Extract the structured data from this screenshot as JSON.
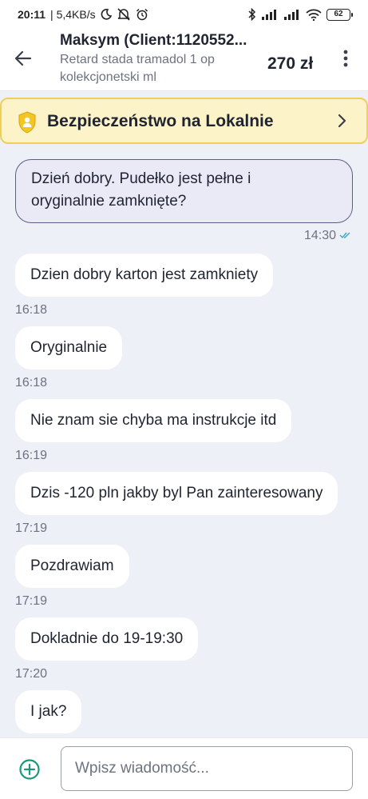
{
  "status_bar": {
    "time": "20:11",
    "speed": "| 5,4KB/s",
    "battery": "62",
    "icons": [
      "moon-icon",
      "mute-icon",
      "alarm-icon",
      "bluetooth-icon",
      "signal-icon",
      "signal-icon",
      "wifi-icon",
      "battery-icon"
    ]
  },
  "header": {
    "contact_name": "Maksym (Client:1120552...",
    "subtitle_line1": "Retard stada tramadol 1 op",
    "subtitle_line2": "kolekcjonetski ml",
    "price": "270 zł"
  },
  "banner": {
    "text": "Bezpieczeństwo na Lokalnie",
    "accent_color": "#efcf57",
    "background": "#fdf3c8"
  },
  "messages": [
    {
      "direction": "out",
      "line1": "Dzień dobry. Pudełko jest pełne i",
      "line2": "oryginalnie zamknięte?",
      "time": "14:30"
    },
    {
      "direction": "in",
      "text": "Dzien dobry karton jest zamkniety",
      "time": "16:18"
    },
    {
      "direction": "in",
      "text": "Oryginalnie",
      "time": "16:18"
    },
    {
      "direction": "in",
      "text": "Nie znam sie chyba ma instrukcje itd",
      "time": "16:19"
    },
    {
      "direction": "in",
      "text": "Dzis -120 pln jakby byl Pan zainteresowany",
      "time": "17:19"
    },
    {
      "direction": "in",
      "text": "Pozdrawiam",
      "time": "17:19"
    },
    {
      "direction": "in",
      "text": "Dokladnie do 19-19:30",
      "time": "17:20"
    },
    {
      "direction": "in",
      "text": "I jak?",
      "time": ""
    }
  ],
  "input": {
    "placeholder": "Wpisz wiadomość...",
    "value": ""
  },
  "colors": {
    "chat_background": "#eef0f7",
    "outgoing_bubble": "#eaeaf6",
    "outgoing_border": "#5a5f84",
    "add_button": "#1a9a7a",
    "read_check": "#3aa6c9"
  }
}
